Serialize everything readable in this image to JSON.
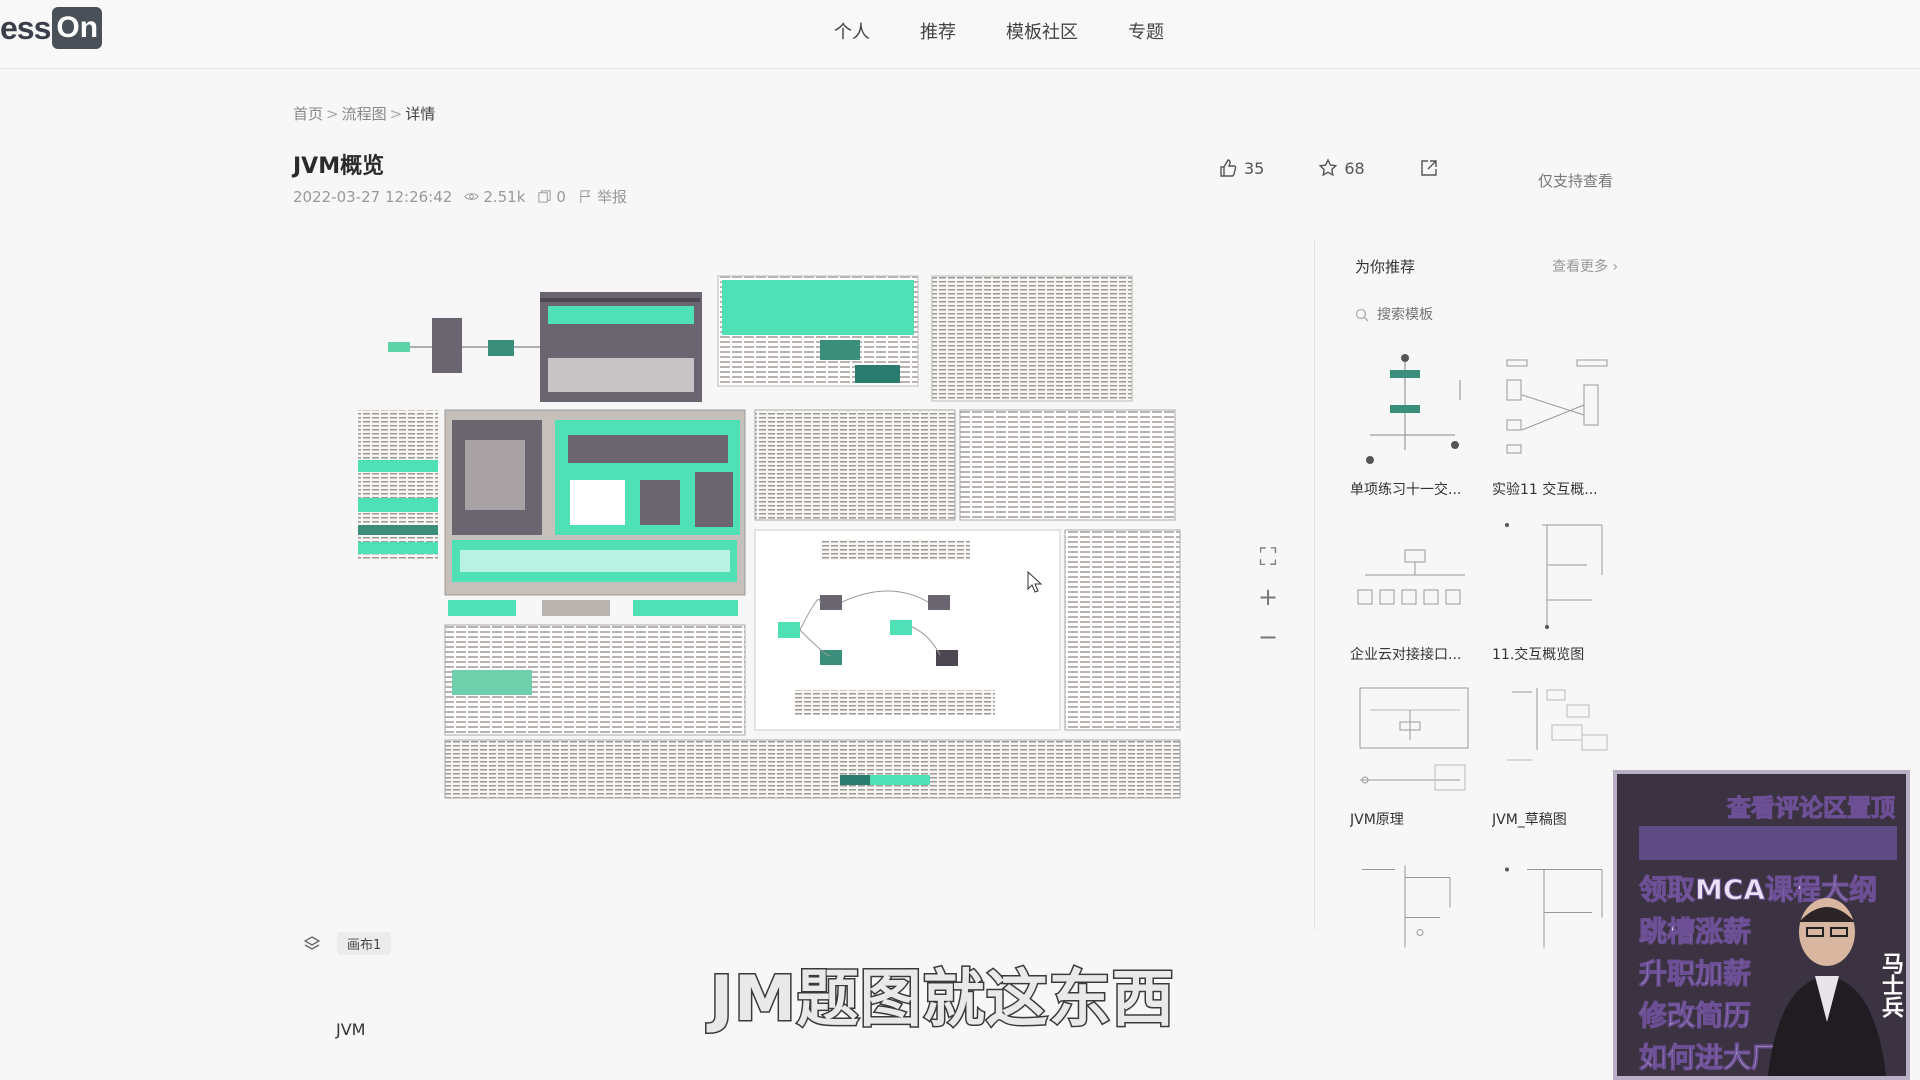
{
  "logo": {
    "text": "ess",
    "badge": "On"
  },
  "nav": {
    "items": [
      "个人",
      "推荐",
      "模板社区",
      "专题"
    ]
  },
  "breadcrumb": {
    "home": "首页",
    "category": "流程图",
    "current": "详情"
  },
  "doc": {
    "title": "JVM概览",
    "datetime": "2022-03-27 12:26:42",
    "views": "2.51k",
    "copies": "0",
    "report": "举报"
  },
  "actions": {
    "likes": "35",
    "stars": "68",
    "view_only": "仅支持查看"
  },
  "canvas": {
    "page_chip": "画布1",
    "tag": "JVM"
  },
  "sidebar": {
    "heading": "为你推荐",
    "more": "查看更多",
    "search_placeholder": "搜索模板",
    "templates": [
      {
        "label": "单项练习十一交..."
      },
      {
        "label": "实验11 交互概..."
      },
      {
        "label": "企业云对接接口..."
      },
      {
        "label": "11.交互概览图"
      },
      {
        "label": "JVM原理"
      },
      {
        "label": "JVM_草稿图"
      }
    ]
  },
  "ad": {
    "line1": "查看评论区置顶",
    "line3": "领取MCA课程大纲",
    "line4": "跳槽涨薪",
    "line5": "升职加薪",
    "line6": "修改简历",
    "line7": "如何进大厂",
    "name": "马士兵"
  },
  "subtitle": "JM题图就这东西",
  "colors": {
    "accent": "#4fe0b5",
    "dark": "#6b6570",
    "bg": "#f7f7f8"
  }
}
